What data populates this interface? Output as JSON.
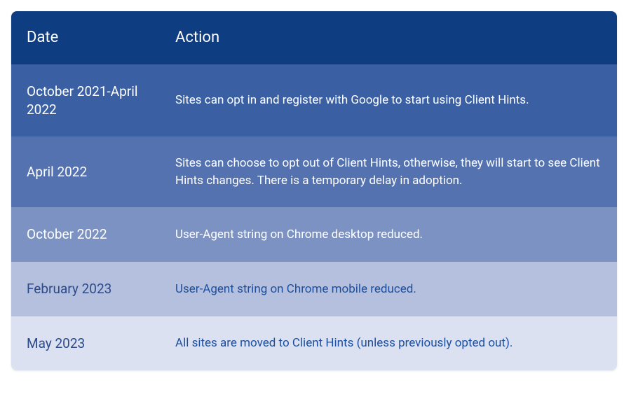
{
  "headers": {
    "date": "Date",
    "action": "Action"
  },
  "rows": [
    {
      "date": "October 2021-April 2022",
      "action": "Sites can opt in and register with Google to start using Client Hints."
    },
    {
      "date": "April 2022",
      "action": "Sites can choose to opt out of Client Hints, otherwise, they will start to see Client Hints changes. There is a temporary delay in adoption."
    },
    {
      "date": "October 2022",
      "action": "User-Agent string on Chrome desktop reduced."
    },
    {
      "date": "February 2023",
      "action": "User-Agent string on Chrome mobile reduced."
    },
    {
      "date": "May 2023",
      "action": "All sites are moved to Client Hints (unless previously opted out)."
    }
  ]
}
